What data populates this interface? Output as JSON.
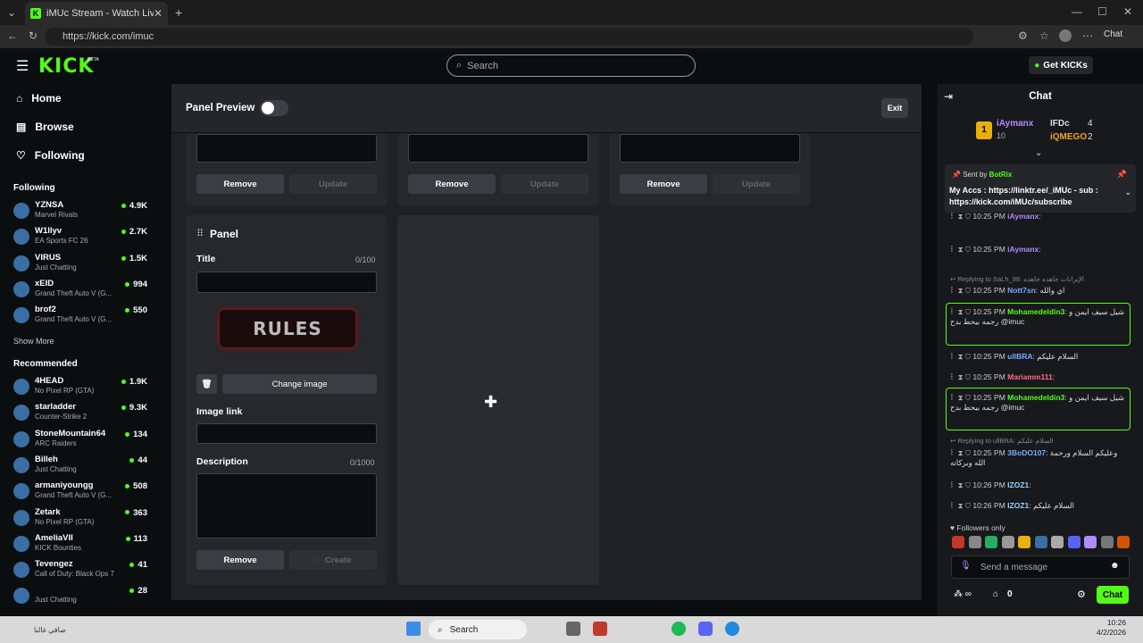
{
  "browser": {
    "tab_title": "iMUc Stream - Watch Live on Kick",
    "url": "https://kick.com/imuc",
    "chat_label": "Chat"
  },
  "header": {
    "logo": "KICK",
    "logo_badge": "BETA",
    "search_placeholder": "Search",
    "get_kicks": "Get KICKs"
  },
  "sidebar": {
    "nav": [
      {
        "label": "Home",
        "icon": "home-icon"
      },
      {
        "label": "Browse",
        "icon": "browse-icon"
      },
      {
        "label": "Following",
        "icon": "heart-icon"
      }
    ],
    "following_title": "Following",
    "following": [
      {
        "name": "YZNSA",
        "category": "Marvel Rivals",
        "viewers": "4.9K"
      },
      {
        "name": "W1llyv",
        "category": "EA Sports FC 26",
        "viewers": "2.7K"
      },
      {
        "name": "VIRUS",
        "category": "Just Chatting",
        "viewers": "1.5K"
      },
      {
        "name": "xEID",
        "category": "Grand Theft Auto V (G...",
        "viewers": "994"
      },
      {
        "name": "brof2",
        "category": "Grand Theft Auto V (G...",
        "viewers": "550"
      }
    ],
    "show_more": "Show More",
    "recommended_title": "Recommended",
    "recommended": [
      {
        "name": "4HEAD",
        "category": "No Pixel RP (GTA)",
        "viewers": "1.9K"
      },
      {
        "name": "starladder",
        "category": "Counter-Strike 2",
        "viewers": "9.3K"
      },
      {
        "name": "StoneMountain64",
        "category": "ARC Raiders",
        "viewers": "134"
      },
      {
        "name": "Billeh",
        "category": "Just Chatting",
        "viewers": "44"
      },
      {
        "name": "armaniyoungg",
        "category": "Grand Theft Auto V (G...",
        "viewers": "508"
      },
      {
        "name": "Zetark",
        "category": "No Pixel RP (GTA)",
        "viewers": "363"
      },
      {
        "name": "AmeliaVII",
        "category": "KICK Bounties",
        "viewers": "113"
      },
      {
        "name": "Tevengez",
        "category": "Call of Duty: Black Ops 7",
        "viewers": "41"
      },
      {
        "name": "",
        "category": "Just Chatting",
        "viewers": "28"
      }
    ]
  },
  "panel": {
    "preview_label": "Panel Preview",
    "exit": "Exit",
    "remove": "Remove",
    "update": "Update",
    "panel_heading": "Panel",
    "title_label": "Title",
    "title_count": "0/100",
    "image_text": "RULES",
    "change_image": "Change image",
    "image_link_label": "Image link",
    "description_label": "Description",
    "description_count": "0/1000",
    "create": "Create"
  },
  "chat": {
    "title": "Chat",
    "leaders": [
      {
        "name": "iAymanx",
        "rank": "1",
        "score": "10"
      },
      {
        "name": "IFDc",
        "score": "4"
      },
      {
        "name": "iQMEGO",
        "score": "2"
      }
    ],
    "pinned_sender": "Sent by",
    "pinned_bot": "BotRix",
    "pinned_text": "My Accs : https://linktr.ee/_iMUc - sub : https://kick.com/iMUc/subscribe",
    "messages": [
      {
        "time": "10:25 PM",
        "user": "iAymanx",
        "text": ":",
        "color": "#b18cff"
      },
      {
        "time": "10:25 PM",
        "user": "iAymanx",
        "text": ":",
        "color": "#b18cff"
      },
      {
        "reply": "Replying to SaLh_98: الإيرانات جاهده جاهده"
      },
      {
        "time": "10:25 PM",
        "user": "Nott7sn",
        "text": ": اي والله",
        "color": "#7aa8ff"
      },
      {
        "time": "10:25 PM",
        "user": "Mohamedeldin3",
        "text": ": شيل سيف ايمن و رجمه بيحط بدح @imuc",
        "color": "#53fc18"
      },
      {
        "time": "10:25 PM",
        "user": "ullBRA",
        "text": ": السلام عليكم",
        "color": "#7aa8ff"
      },
      {
        "time": "10:25 PM",
        "user": "Mariamm111",
        "text": ":",
        "color": "#ff6b8a"
      },
      {
        "time": "10:25 PM",
        "user": "Mohamedeldin3",
        "text": ": شيل سيف ايمن و رجمه بيحط بدح @imuc",
        "color": "#53fc18"
      },
      {
        "reply": "Replying to ullBRA: السلام عليكم"
      },
      {
        "time": "10:25 PM",
        "user": "3BoDO107",
        "text": ": وعليكم السلام ورحمة الله وبركاته",
        "color": "#7aa8ff"
      },
      {
        "time": "10:26 PM",
        "user": "IZOZ1",
        "text": ":",
        "color": "#9bd0ff"
      },
      {
        "time": "10:26 PM",
        "user": "IZOZ1",
        "text": ": السلام عليكم",
        "color": "#9bd0ff"
      }
    ],
    "followers_only": "Followers only",
    "send_placeholder": "Send a message",
    "points": "0",
    "chat_button": "Chat"
  },
  "taskbar": {
    "search": "Search",
    "time": "10:26",
    "date": "4/2/2026",
    "left_text": "صافي غالنا"
  }
}
